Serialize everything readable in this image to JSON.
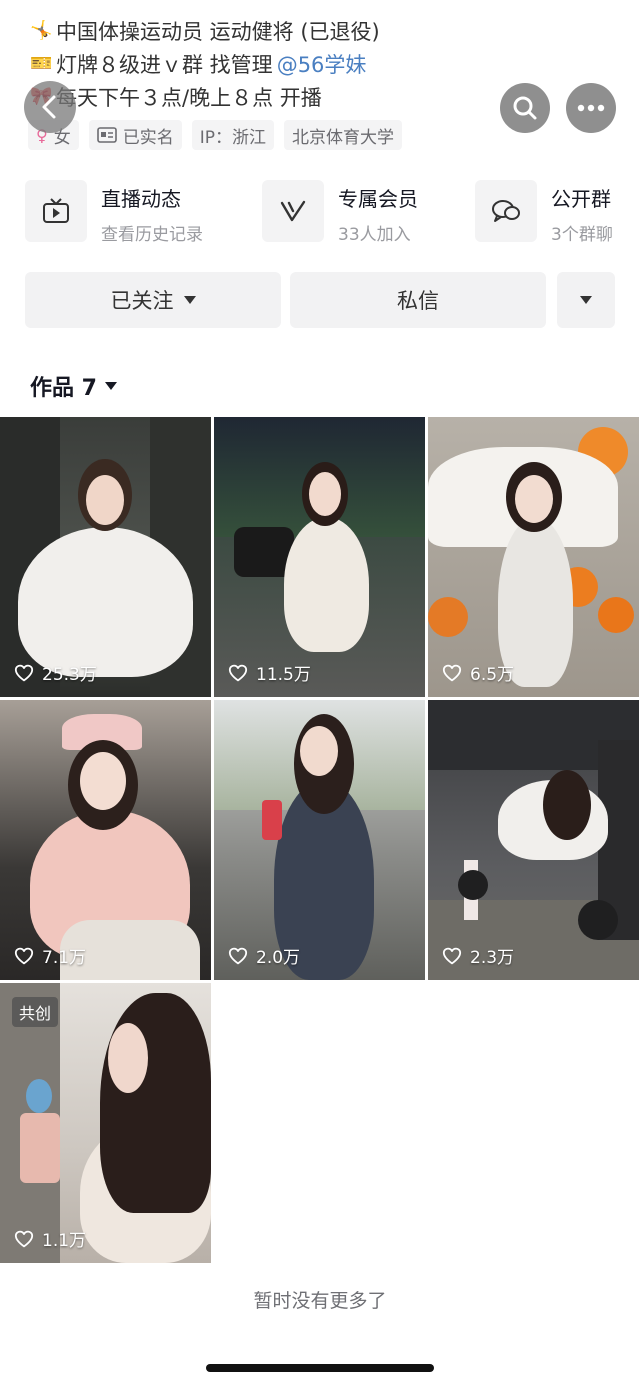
{
  "bio": {
    "line1": "中国体操运动员 运动健将 (已退役)",
    "line2_text": "灯牌８级进ｖ群 找管理",
    "line2_mention": "@56学妹",
    "line3": "每天下午３点/晚上８点 开播"
  },
  "tags": {
    "gender": "女",
    "verified": "已实名",
    "ip": "IP：浙江",
    "school": "北京体育大学"
  },
  "services": [
    {
      "title": "直播动态",
      "sub": "查看历史记录",
      "icon": "tv-icon"
    },
    {
      "title": "专属会员",
      "sub": "33人加入",
      "icon": "v-member-icon"
    },
    {
      "title": "公开群",
      "sub": "3个群聊",
      "icon": "chat-group-icon"
    }
  ],
  "actions": {
    "follow": "已关注",
    "message": "私信"
  },
  "works": {
    "label": "作品 7"
  },
  "tiles": [
    {
      "likes": "25.3万"
    },
    {
      "likes": "11.5万"
    },
    {
      "likes": "6.5万"
    },
    {
      "likes": "7.1万"
    },
    {
      "likes": "2.0万"
    },
    {
      "likes": "2.3万"
    },
    {
      "likes": "1.1万",
      "badge": "共创"
    }
  ],
  "footer": {
    "end_text": "暂时没有更多了"
  },
  "colors": {
    "accent_link": "#4a7fc1",
    "chip_bg": "#f2f2f3"
  }
}
